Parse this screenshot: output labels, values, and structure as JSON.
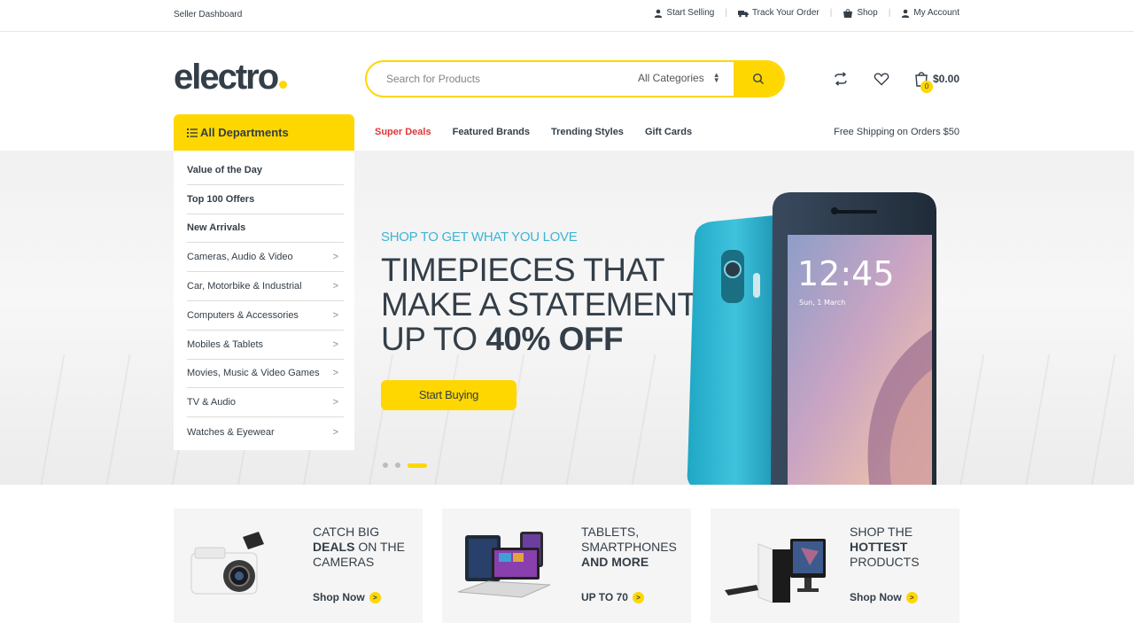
{
  "topbar": {
    "seller_dashboard": "Seller Dashboard",
    "links": [
      {
        "label": "Start Selling",
        "icon": "user-icon"
      },
      {
        "label": "Track Your Order",
        "icon": "truck-icon"
      },
      {
        "label": "Shop",
        "icon": "bag-icon"
      },
      {
        "label": "My Account",
        "icon": "user-icon"
      }
    ],
    "separator": "|"
  },
  "header": {
    "logo": "electro",
    "search": {
      "placeholder": "Search for Products",
      "category": "All Categories",
      "button_icon": "search-icon"
    },
    "icons": [
      "compare-icon",
      "heart-icon"
    ],
    "cart": {
      "count": "0",
      "total": "$0.00",
      "icon": "cart-bag-icon"
    }
  },
  "nav": {
    "departments_label": "All Departments",
    "links": [
      "Super Deals",
      "Featured Brands",
      "Trending Styles",
      "Gift Cards"
    ],
    "free_shipping": "Free Shipping on Orders $50"
  },
  "departments": [
    {
      "label": "Value of the Day",
      "bold": true,
      "submenu": false
    },
    {
      "label": "Top 100 Offers",
      "bold": true,
      "submenu": false
    },
    {
      "label": "New Arrivals",
      "bold": true,
      "submenu": false
    },
    {
      "label": "Cameras, Audio & Video",
      "bold": false,
      "submenu": true
    },
    {
      "label": "Car, Motorbike & Industrial",
      "bold": false,
      "submenu": true
    },
    {
      "label": "Computers & Accessories",
      "bold": false,
      "submenu": true
    },
    {
      "label": "Mobiles & Tablets",
      "bold": false,
      "submenu": true
    },
    {
      "label": "Movies, Music & Video Games",
      "bold": false,
      "submenu": true
    },
    {
      "label": "TV & Audio",
      "bold": false,
      "submenu": true
    },
    {
      "label": "Watches & Eyewear",
      "bold": false,
      "submenu": true
    }
  ],
  "hero": {
    "subtitle": "SHOP TO GET WHAT YOU LOVE",
    "line1": "TIMEPIECES THAT",
    "line2": "MAKE A STATEMENT",
    "line3_prefix": "UP TO ",
    "line3_bold": "40% OFF",
    "cta": "Start Buying",
    "slides": 3,
    "active_slide": 3,
    "phone_time": "12:45",
    "phone_date": "Sun, 1 March"
  },
  "banners": [
    {
      "line1": "CATCH BIG",
      "line2_bold": "DEALS",
      "line2_rest": " ON THE",
      "line3": "CAMERAS",
      "link": "Shop Now",
      "image": "camera-image"
    },
    {
      "line1": "TABLETS,",
      "line2_bold": "",
      "line2_rest": "SMARTPHONES",
      "line3": "AND MORE",
      "link": "UP TO 70",
      "image": "tablets-image"
    },
    {
      "line1": "SHOP THE",
      "line2_bold": "HOTTEST",
      "line2_rest": "",
      "line3": "PRODUCTS",
      "link": "Shop Now",
      "image": "desktop-image"
    }
  ],
  "colors": {
    "accent": "#fed700",
    "text": "#333e48",
    "deal": "#df3737",
    "subtitle": "#3db4d3"
  }
}
